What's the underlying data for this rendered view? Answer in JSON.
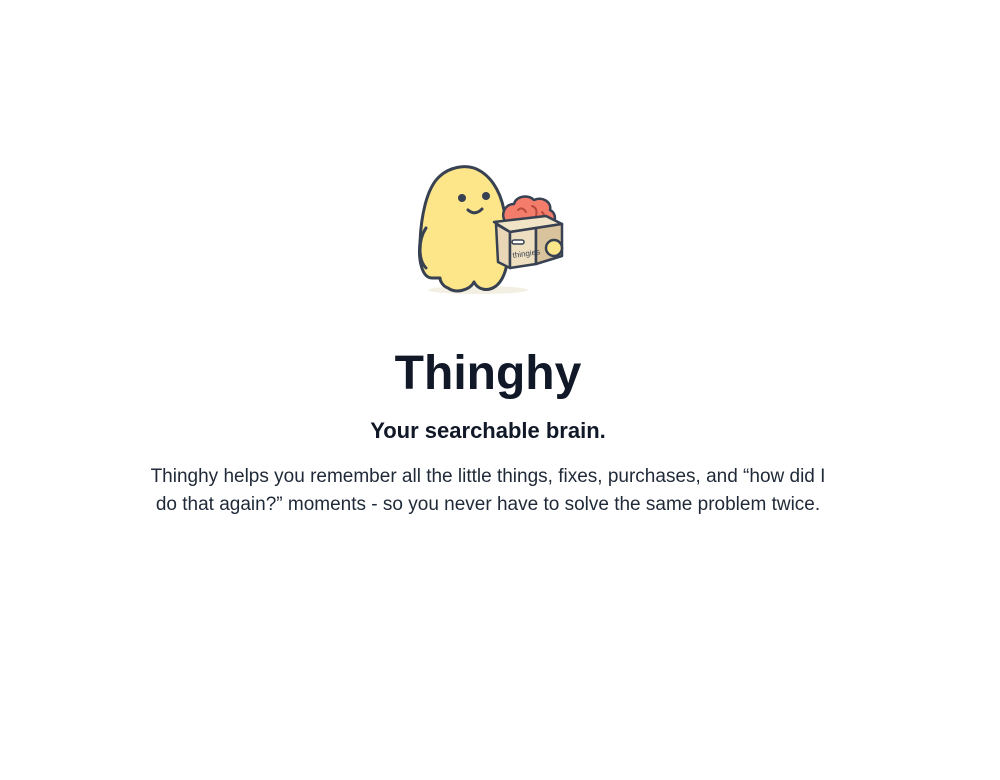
{
  "hero": {
    "mascot_icon": "thingy-mascot-with-brain-box",
    "box_label": "thingies",
    "title": "Thinghy",
    "tagline": "Your searchable brain.",
    "description": "Thinghy helps you remember all the little things, fixes, purchases, and “how did I do that again?” moments - so you never have to solve the same problem twice."
  },
  "colors": {
    "mascot_body": "#fde68a",
    "outline": "#374151",
    "brain": "#f47c6b",
    "box": "#e8d6b6",
    "text": "#111827"
  }
}
